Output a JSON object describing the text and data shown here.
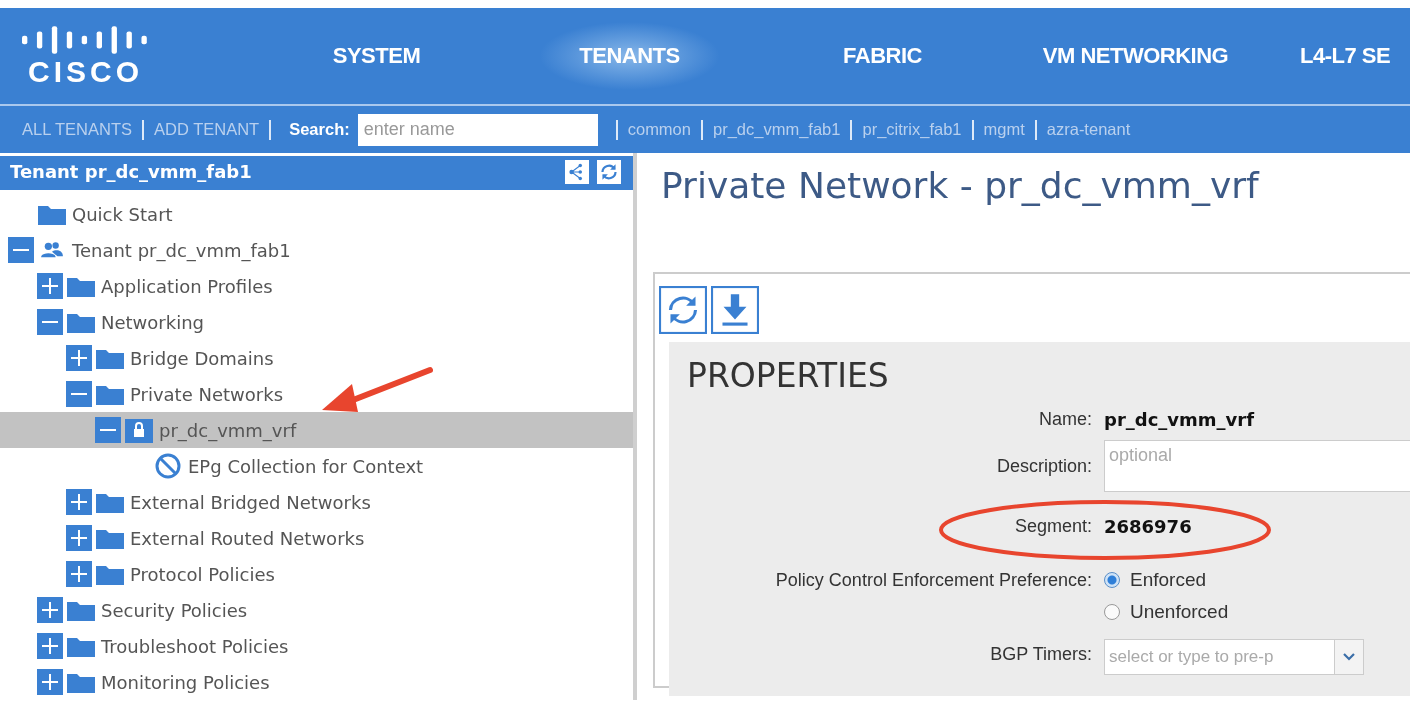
{
  "logo": {
    "text": "CISCO"
  },
  "nav": [
    {
      "label": "SYSTEM",
      "selected": false
    },
    {
      "label": "TENANTS",
      "selected": true
    },
    {
      "label": "FABRIC",
      "selected": false
    },
    {
      "label": "VM NETWORKING",
      "selected": false
    },
    {
      "label": "L4-L7 SE",
      "selected": false
    }
  ],
  "subnav": {
    "links": [
      "ALL TENANTS",
      "ADD TENANT"
    ],
    "search_label": "Search:",
    "search": {
      "placeholder": "enter name"
    },
    "tenants": [
      "common",
      "pr_dc_vmm_fab1",
      "pr_citrix_fab1",
      "mgmt",
      "azra-tenant"
    ]
  },
  "tree_header": {
    "title": "Tenant pr_dc_vmm_fab1"
  },
  "tree": [
    {
      "label": "Quick Start",
      "kind": "folder",
      "selected": false
    },
    {
      "label": "Tenant pr_dc_vmm_fab1",
      "kind": "tenant",
      "expanded": true,
      "selected": false,
      "children": [
        {
          "label": "Application Profiles",
          "kind": "folder",
          "expanded": false,
          "selected": false
        },
        {
          "label": "Networking",
          "kind": "folder",
          "expanded": true,
          "selected": false,
          "children": [
            {
              "label": "Bridge Domains",
              "kind": "folder",
              "expanded": false,
              "selected": false
            },
            {
              "label": "Private Networks",
              "kind": "folder",
              "expanded": true,
              "selected": false,
              "children": [
                {
                  "label": "pr_dc_vmm_vrf",
                  "kind": "network",
                  "expanded": true,
                  "selected": true,
                  "children": [
                    {
                      "label": "EPg Collection for Context",
                      "kind": "collection",
                      "selected": false
                    }
                  ]
                }
              ]
            },
            {
              "label": "External Bridged Networks",
              "kind": "folder",
              "expanded": false,
              "selected": false
            },
            {
              "label": "External Routed Networks",
              "kind": "folder",
              "expanded": false,
              "selected": false
            },
            {
              "label": "Protocol Policies",
              "kind": "folder",
              "expanded": false,
              "selected": false
            }
          ]
        },
        {
          "label": "Security Policies",
          "kind": "folder",
          "expanded": false,
          "selected": false
        },
        {
          "label": "Troubleshoot Policies",
          "kind": "folder",
          "expanded": false,
          "selected": false
        },
        {
          "label": "Monitoring Policies",
          "kind": "folder",
          "expanded": false,
          "selected": false
        }
      ]
    }
  ],
  "content": {
    "title": "Private Network - pr_dc_vmm_vrf",
    "properties": {
      "heading": "PROPERTIES",
      "name": {
        "label": "Name:",
        "value": "pr_dc_vmm_vrf"
      },
      "description": {
        "label": "Description:",
        "placeholder": "optional"
      },
      "segment": {
        "label": "Segment:",
        "value": "2686976"
      },
      "enforcement": {
        "label": "Policy Control Enforcement Preference:",
        "options": [
          {
            "label": "Enforced",
            "selected": true
          },
          {
            "label": "Unenforced",
            "selected": false
          }
        ]
      },
      "bgp_timers": {
        "label": "BGP Timers:",
        "placeholder": "select or type to pre-p"
      }
    }
  }
}
